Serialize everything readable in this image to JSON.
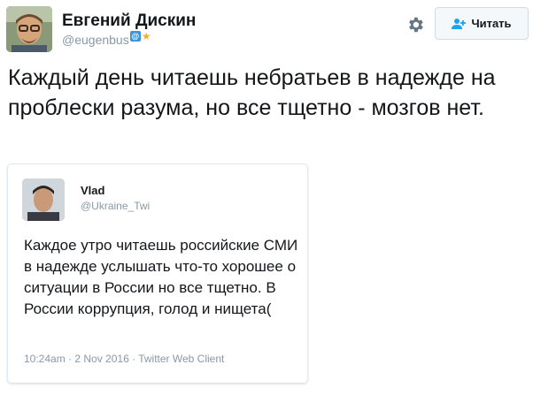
{
  "author": {
    "display_name": "Евгений Дискин",
    "handle": "@eugenbus",
    "badge_icon": "at-badge-icon",
    "badge_text": "@"
  },
  "actions": {
    "settings_icon": "gear-icon",
    "follow_label": "Читать",
    "follow_icon": "add-user-icon"
  },
  "tweet": {
    "text": "Каждый день читаешь небратьев в надежде на проблески разума, но все тщетно - мозгов нет."
  },
  "quoted_tweet": {
    "name": "Vlad",
    "handle": "@Ukraine_Twi",
    "text": "Каждое утро читаешь российские СМИ в надежде услышать что-то хорошее о ситуации в России но все тщетно. В России коррупция, голод и нищета(",
    "timestamp": "10:24am · 2 Nov 2016 · Twitter Web Client"
  },
  "colors": {
    "link": "#1da1f2",
    "muted": "#8899a6",
    "border": "#e1e8ed"
  }
}
